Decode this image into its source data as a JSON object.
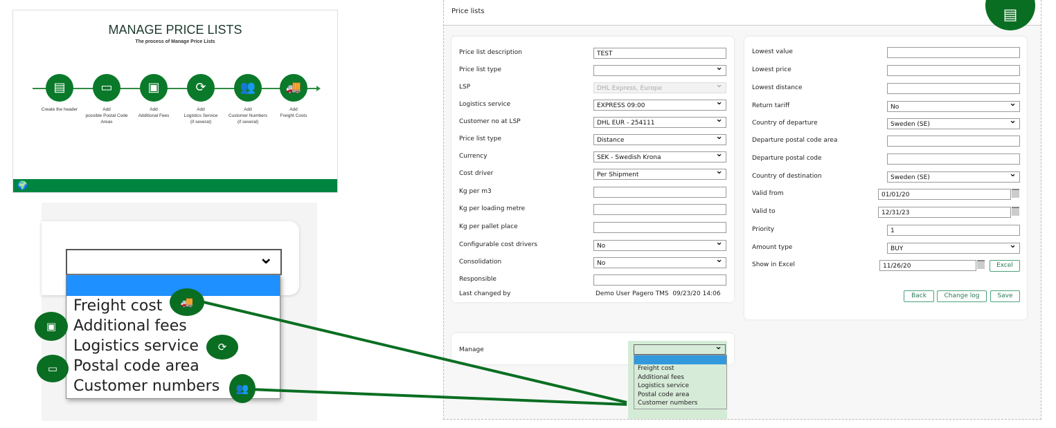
{
  "slide": {
    "title": "MANAGE PRICE LISTS",
    "subtitle": "The process of Manage Price Lists",
    "steps": [
      {
        "label": "Create the header",
        "icon": "document-icon"
      },
      {
        "label": "Add\npossible Postal Code\nAreas",
        "icon": "postal-map-icon"
      },
      {
        "label": "Add\nAdditional Fees",
        "icon": "trolley-icon"
      },
      {
        "label": "Add\nLogistics Service\n(if several)",
        "icon": "logistics-cycle-icon"
      },
      {
        "label": "Add\nCustomer Numbers\n(if several)",
        "icon": "customers-icon"
      },
      {
        "label": "Add\nFreight Costs",
        "icon": "truck-icon"
      }
    ]
  },
  "manage_options": [
    "Freight cost",
    "Additional fees",
    "Logistics service",
    "Postal code area",
    "Customer numbers"
  ],
  "page": {
    "title": "Price lists"
  },
  "left_form": [
    {
      "label": "Price list description",
      "value": "TEST",
      "type": "text"
    },
    {
      "label": "Price list type",
      "value": "",
      "type": "select"
    },
    {
      "label": "LSP",
      "value": "DHL Express, Europe",
      "type": "disabled"
    },
    {
      "label": "Logistics service",
      "value": "EXPRESS 09:00",
      "type": "select"
    },
    {
      "label": "Customer no at LSP",
      "value": "DHL EUR - 254111",
      "type": "select"
    },
    {
      "label": "Price list type",
      "value": "Distance",
      "type": "select"
    },
    {
      "label": "Currency",
      "value": "SEK - Swedish Krona",
      "type": "select"
    },
    {
      "label": "Cost driver",
      "value": "Per Shipment",
      "type": "select"
    },
    {
      "label": "Kg per m3",
      "value": "",
      "type": "text"
    },
    {
      "label": "Kg per loading metre",
      "value": "",
      "type": "text"
    },
    {
      "label": "Kg per pallet place",
      "value": "",
      "type": "text"
    },
    {
      "label": "Configurable cost drivers",
      "value": "No",
      "type": "select"
    },
    {
      "label": "Consolidation",
      "value": "No",
      "type": "select"
    },
    {
      "label": "Responsible",
      "value": "",
      "type": "text"
    }
  ],
  "last_changed": {
    "label": "Last changed by",
    "value": "Demo User Pagero TMS  09/23/20 14:06"
  },
  "right_form": [
    {
      "label": "Lowest value",
      "value": "",
      "type": "text"
    },
    {
      "label": "Lowest price",
      "value": "",
      "type": "text"
    },
    {
      "label": "Lowest distance",
      "value": "",
      "type": "text"
    },
    {
      "label": "Return tariff",
      "value": "No",
      "type": "select"
    },
    {
      "label": "Country of departure",
      "value": "Sweden (SE)",
      "type": "select"
    },
    {
      "label": "Departure postal code area",
      "value": "",
      "type": "text"
    },
    {
      "label": "Departure postal code",
      "value": "",
      "type": "text"
    },
    {
      "label": "Country of destination",
      "value": "Sweden (SE)",
      "type": "select"
    },
    {
      "label": "Valid from",
      "value": "01/01/20",
      "type": "date"
    },
    {
      "label": "Valid to",
      "value": "12/31/23",
      "type": "date"
    },
    {
      "label": "Priority",
      "value": "1",
      "type": "text"
    },
    {
      "label": "Amount type",
      "value": "BUY",
      "type": "select"
    },
    {
      "label": "Show in Excel",
      "value": "11/26/20",
      "type": "excel"
    }
  ],
  "buttons": {
    "excel": "Excel",
    "back": "Back",
    "change_log": "Change log",
    "save": "Save"
  },
  "manage": {
    "label": "Manage"
  },
  "colors": {
    "green": "#0a6e22",
    "blue": "#1e90ff"
  }
}
